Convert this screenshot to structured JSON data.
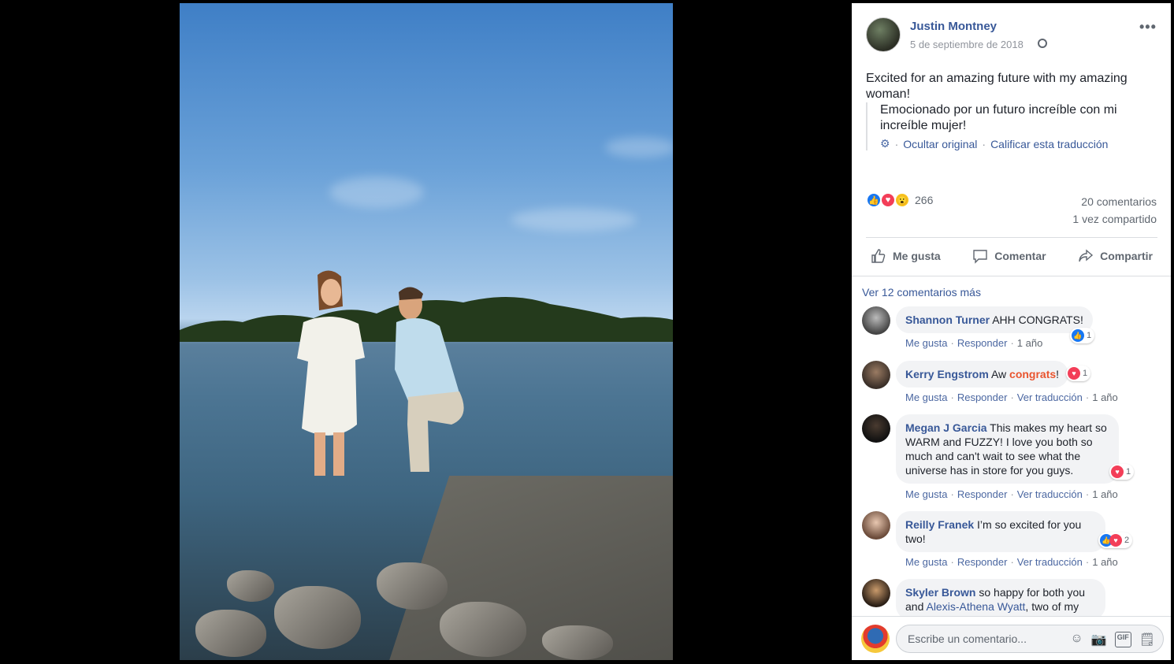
{
  "post": {
    "author": "Justin Montney",
    "date": "5 de septiembre de 2018",
    "text": "Excited for an amazing future with my amazing woman!",
    "translation": "Emocionado por un futuro increíble con mi increíble mujer!",
    "hide_original": "Ocultar original",
    "rate_translation": "Calificar esta traducción",
    "reaction_count": "266",
    "comment_count": "20 comentarios",
    "share_count": "1 vez compartido"
  },
  "actions": {
    "like": "Me gusta",
    "comment": "Comentar",
    "share": "Compartir"
  },
  "comments_header": "Ver 12 comentarios más",
  "comments": [
    {
      "name": "Shannon Turner",
      "text": "AHH CONGRATS!",
      "reactions": "1",
      "like": "Me gusta",
      "reply": "Responder",
      "time": "1 año"
    },
    {
      "name": "Kerry Engstrom",
      "text_before": "Aw",
      "text_highlight": "congrats",
      "text_after": "!",
      "reactions": "1",
      "like": "Me gusta",
      "reply": "Responder",
      "translate": "Ver traducción",
      "time": "1 año"
    },
    {
      "name": "Megan J Garcia",
      "text": "This makes my heart so WARM and FUZZY! I love you both so much and can't wait to see what the universe has in store for you guys.",
      "reactions": "1",
      "like": "Me gusta",
      "reply": "Responder",
      "translate": "Ver traducción",
      "time": "1 año"
    },
    {
      "name": "Reilly Franek",
      "text": "I’m so excited for you two!",
      "reactions": "2",
      "like": "Me gusta",
      "reply": "Responder",
      "translate": "Ver traducción",
      "time": "1 año"
    },
    {
      "name": "Skyler Brown",
      "text_before": "so happy for both you and",
      "mention": "Alexis-Athena Wyatt",
      "text_after": ", two of my"
    }
  ],
  "compose": {
    "placeholder": "Escribe un comentario..."
  },
  "colors": {
    "link": "#385898",
    "like_blue": "#1877f2",
    "love_red": "#f33e58"
  }
}
